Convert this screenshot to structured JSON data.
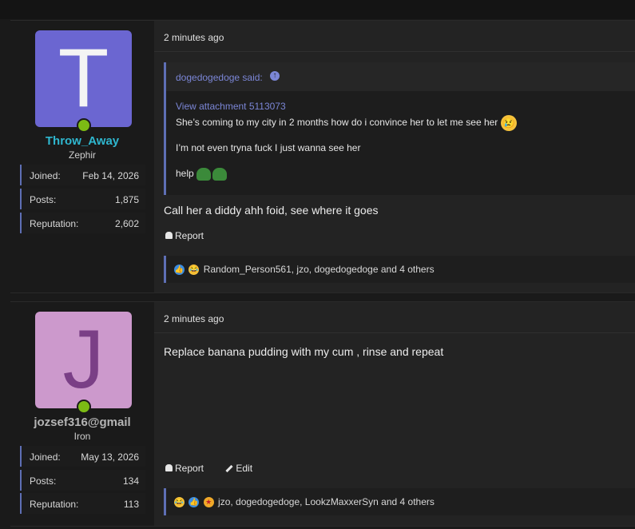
{
  "posts": [
    {
      "user": {
        "avatar_letter": "T",
        "avatar_color": "#6b66d1",
        "name": "Throw_Away",
        "title": "Zephir",
        "stats": [
          {
            "key": "Joined:",
            "value": "Feb 14, 2026"
          },
          {
            "key": "Posts:",
            "value": "1,875"
          },
          {
            "key": "Reputation:",
            "value": "2,602"
          }
        ]
      },
      "time": "2 minutes ago",
      "quote": {
        "author": "dogedogedoge said:",
        "attachment": "View attachment 5113073",
        "lines": [
          "She’s coming to my city in 2 months how do i convince her to let me see her",
          "I’m not even tryna fuck I just wanna see her",
          "help"
        ]
      },
      "message": "Call her a diddy ahh foid, see where it goes",
      "actions": {
        "report": "Report"
      },
      "reactions": {
        "text": "Random_Person561, jzo, dogedogedoge and 4 others"
      }
    },
    {
      "user": {
        "avatar_letter": "J",
        "avatar_color": "#cc99cc",
        "name": "jozsef316@gmail",
        "title": "Iron",
        "stats": [
          {
            "key": "Joined:",
            "value": "May 13, 2026"
          },
          {
            "key": "Posts:",
            "value": "134"
          },
          {
            "key": "Reputation:",
            "value": "113"
          }
        ]
      },
      "time": "2 minutes ago",
      "message": "Replace banana pudding with my cum , rinse and repeat",
      "actions": {
        "report": "Report",
        "edit": "Edit"
      },
      "reactions": {
        "text": "jzo, dogedogedoge, LookzMaxxerSyn and 4 others"
      }
    }
  ],
  "colors": {
    "accent": "#5e6fb5",
    "link": "#7b86d6",
    "online": "#7cbb14"
  }
}
